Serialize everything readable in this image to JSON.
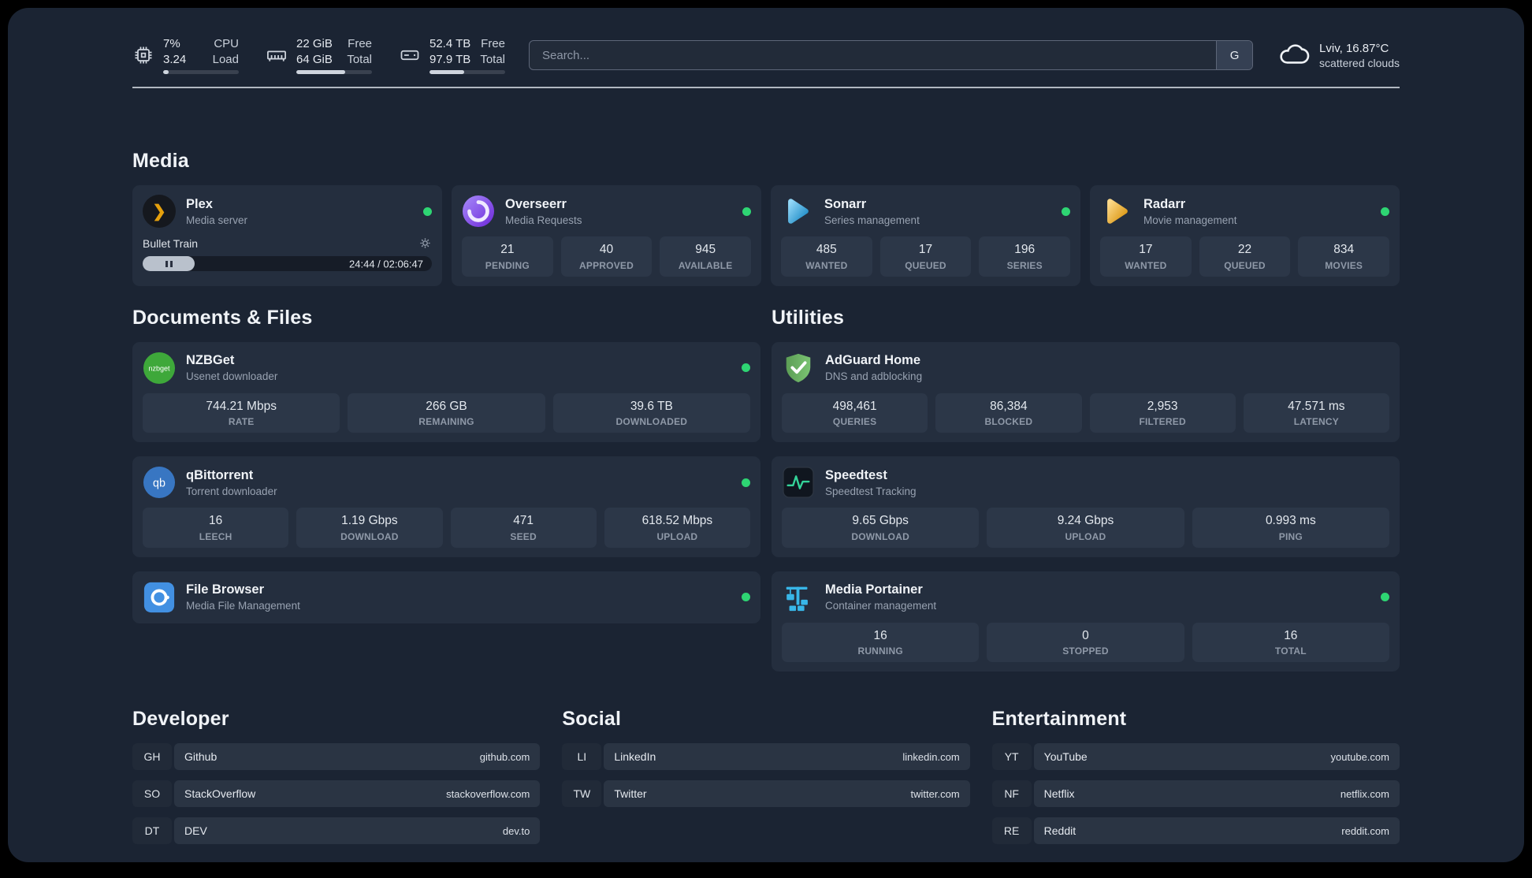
{
  "colors": {
    "status_green": "#2ed573",
    "plex_gold": "#e5a00d"
  },
  "topbar": {
    "cpu": {
      "value1": "7%",
      "label1": "CPU",
      "value2": "3.24",
      "label2": "Load",
      "percent": 7
    },
    "memory": {
      "value1": "22 GiB",
      "label1": "Free",
      "value2": "64 GiB",
      "label2": "Total",
      "percent": 65
    },
    "disk": {
      "value1": "52.4 TB",
      "label1": "Free",
      "value2": "97.9 TB",
      "label2": "Total",
      "percent": 46
    },
    "search": {
      "placeholder": "Search...",
      "button_label": "G"
    },
    "weather": {
      "location": "Lviv, 16.87°C",
      "condition": "scattered clouds"
    }
  },
  "icons": {
    "plex_glyph": "❯",
    "qb_glyph": "qb",
    "nzbget_glyph": "nzbget"
  },
  "groups": {
    "media": {
      "title": "Media",
      "plex": {
        "name": "Plex",
        "desc": "Media server",
        "now_playing": "Bullet Train",
        "time": "24:44 / 02:06:47",
        "progress_percent": 18
      },
      "overseerr": {
        "name": "Overseerr",
        "desc": "Media Requests",
        "stats": [
          {
            "value": "21",
            "label": "PENDING"
          },
          {
            "value": "40",
            "label": "APPROVED"
          },
          {
            "value": "945",
            "label": "AVAILABLE"
          }
        ]
      },
      "sonarr": {
        "name": "Sonarr",
        "desc": "Series management",
        "stats": [
          {
            "value": "485",
            "label": "WANTED"
          },
          {
            "value": "17",
            "label": "QUEUED"
          },
          {
            "value": "196",
            "label": "SERIES"
          }
        ]
      },
      "radarr": {
        "name": "Radarr",
        "desc": "Movie management",
        "stats": [
          {
            "value": "17",
            "label": "WANTED"
          },
          {
            "value": "22",
            "label": "QUEUED"
          },
          {
            "value": "834",
            "label": "MOVIES"
          }
        ]
      }
    },
    "documents": {
      "title": "Documents & Files",
      "nzbget": {
        "name": "NZBGet",
        "desc": "Usenet downloader",
        "stats": [
          {
            "value": "744.21 Mbps",
            "label": "RATE"
          },
          {
            "value": "266 GB",
            "label": "REMAINING"
          },
          {
            "value": "39.6 TB",
            "label": "DOWNLOADED"
          }
        ]
      },
      "qbittorrent": {
        "name": "qBittorrent",
        "desc": "Torrent downloader",
        "stats": [
          {
            "value": "16",
            "label": "LEECH"
          },
          {
            "value": "1.19 Gbps",
            "label": "DOWNLOAD"
          },
          {
            "value": "471",
            "label": "SEED"
          },
          {
            "value": "618.52 Mbps",
            "label": "UPLOAD"
          }
        ]
      },
      "filebrowser": {
        "name": "File Browser",
        "desc": "Media File Management"
      }
    },
    "utilities": {
      "title": "Utilities",
      "adguard": {
        "name": "AdGuard Home",
        "desc": "DNS and adblocking",
        "stats": [
          {
            "value": "498,461",
            "label": "QUERIES"
          },
          {
            "value": "86,384",
            "label": "BLOCKED"
          },
          {
            "value": "2,953",
            "label": "FILTERED"
          },
          {
            "value": "47.571 ms",
            "label": "LATENCY"
          }
        ]
      },
      "speedtest": {
        "name": "Speedtest",
        "desc": "Speedtest Tracking",
        "stats": [
          {
            "value": "9.65 Gbps",
            "label": "DOWNLOAD"
          },
          {
            "value": "9.24 Gbps",
            "label": "UPLOAD"
          },
          {
            "value": "0.993 ms",
            "label": "PING"
          }
        ]
      },
      "portainer": {
        "name": "Media Portainer",
        "desc": "Container management",
        "stats": [
          {
            "value": "16",
            "label": "RUNNING"
          },
          {
            "value": "0",
            "label": "STOPPED"
          },
          {
            "value": "16",
            "label": "TOTAL"
          }
        ]
      }
    }
  },
  "bookmarks": [
    {
      "title": "Developer",
      "items": [
        {
          "abbr": "GH",
          "name": "Github",
          "url": "github.com"
        },
        {
          "abbr": "SO",
          "name": "StackOverflow",
          "url": "stackoverflow.com"
        },
        {
          "abbr": "DT",
          "name": "DEV",
          "url": "dev.to"
        }
      ]
    },
    {
      "title": "Social",
      "items": [
        {
          "abbr": "LI",
          "name": "LinkedIn",
          "url": "linkedin.com"
        },
        {
          "abbr": "TW",
          "name": "Twitter",
          "url": "twitter.com"
        }
      ]
    },
    {
      "title": "Entertainment",
      "items": [
        {
          "abbr": "YT",
          "name": "YouTube",
          "url": "youtube.com"
        },
        {
          "abbr": "NF",
          "name": "Netflix",
          "url": "netflix.com"
        },
        {
          "abbr": "RE",
          "name": "Reddit",
          "url": "reddit.com"
        }
      ]
    }
  ]
}
